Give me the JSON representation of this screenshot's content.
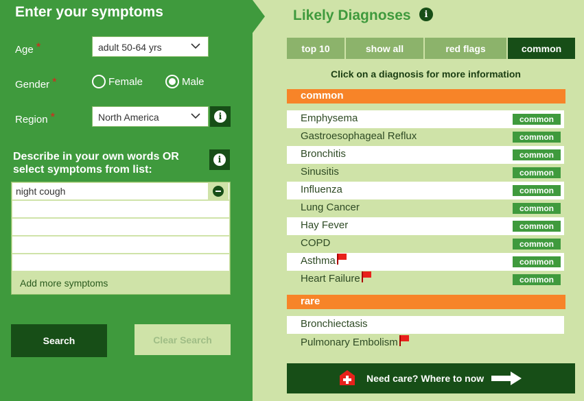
{
  "left": {
    "title": "Enter your symptoms",
    "age_label": "Age",
    "age_value": "adult 50-64 yrs",
    "gender_label": "Gender",
    "gender_options": [
      "Female",
      "Male"
    ],
    "gender_selected": "Male",
    "region_label": "Region",
    "region_value": "North America",
    "required_mark": "*",
    "describe_text": "Describe in your own words OR select symptoms from list:",
    "symptoms": [
      "night cough",
      "",
      "",
      "",
      ""
    ],
    "add_more": "Add more symptoms",
    "search_label": "Search",
    "clear_label": "Clear Search"
  },
  "right": {
    "title": "Likely Diagnoses",
    "info_glyph": "i",
    "tabs": [
      {
        "label": "top 10",
        "active": false
      },
      {
        "label": "show all",
        "active": false
      },
      {
        "label": "red flags",
        "active": false
      },
      {
        "label": "common",
        "active": true
      }
    ],
    "instructions": "Click on a diagnosis for more information",
    "sections": [
      {
        "heading": "common",
        "items": [
          {
            "name": "Emphysema",
            "badge": "common",
            "red_flag": false
          },
          {
            "name": "Gastroesophageal Reflux",
            "badge": "common",
            "red_flag": false
          },
          {
            "name": "Bronchitis",
            "badge": "common",
            "red_flag": false
          },
          {
            "name": "Sinusitis",
            "badge": "common",
            "red_flag": false
          },
          {
            "name": "Influenza",
            "badge": "common",
            "red_flag": false
          },
          {
            "name": "Lung Cancer",
            "badge": "common",
            "red_flag": false
          },
          {
            "name": "Hay Fever",
            "badge": "common",
            "red_flag": false
          },
          {
            "name": "COPD",
            "badge": "common",
            "red_flag": false
          },
          {
            "name": "Asthma",
            "badge": "common",
            "red_flag": true
          },
          {
            "name": "Heart Failure",
            "badge": "common",
            "red_flag": true
          }
        ]
      },
      {
        "heading": "rare",
        "items": [
          {
            "name": "Bronchiectasis",
            "badge": "",
            "red_flag": false
          },
          {
            "name": "Pulmonary Embolism",
            "badge": "",
            "red_flag": true
          }
        ]
      }
    ],
    "care_text": "Need care?  Where to now"
  },
  "colors": {
    "dark_green": "#174e17",
    "mid_green": "#3f9a3d",
    "light_green": "#cfe3a8",
    "orange": "#f78428",
    "flag_red": "#e8211b"
  },
  "icons": [
    "chevron-down-icon",
    "info-icon",
    "remove-icon",
    "red-flag-icon",
    "first-aid-icon",
    "arrow-right-icon"
  ]
}
